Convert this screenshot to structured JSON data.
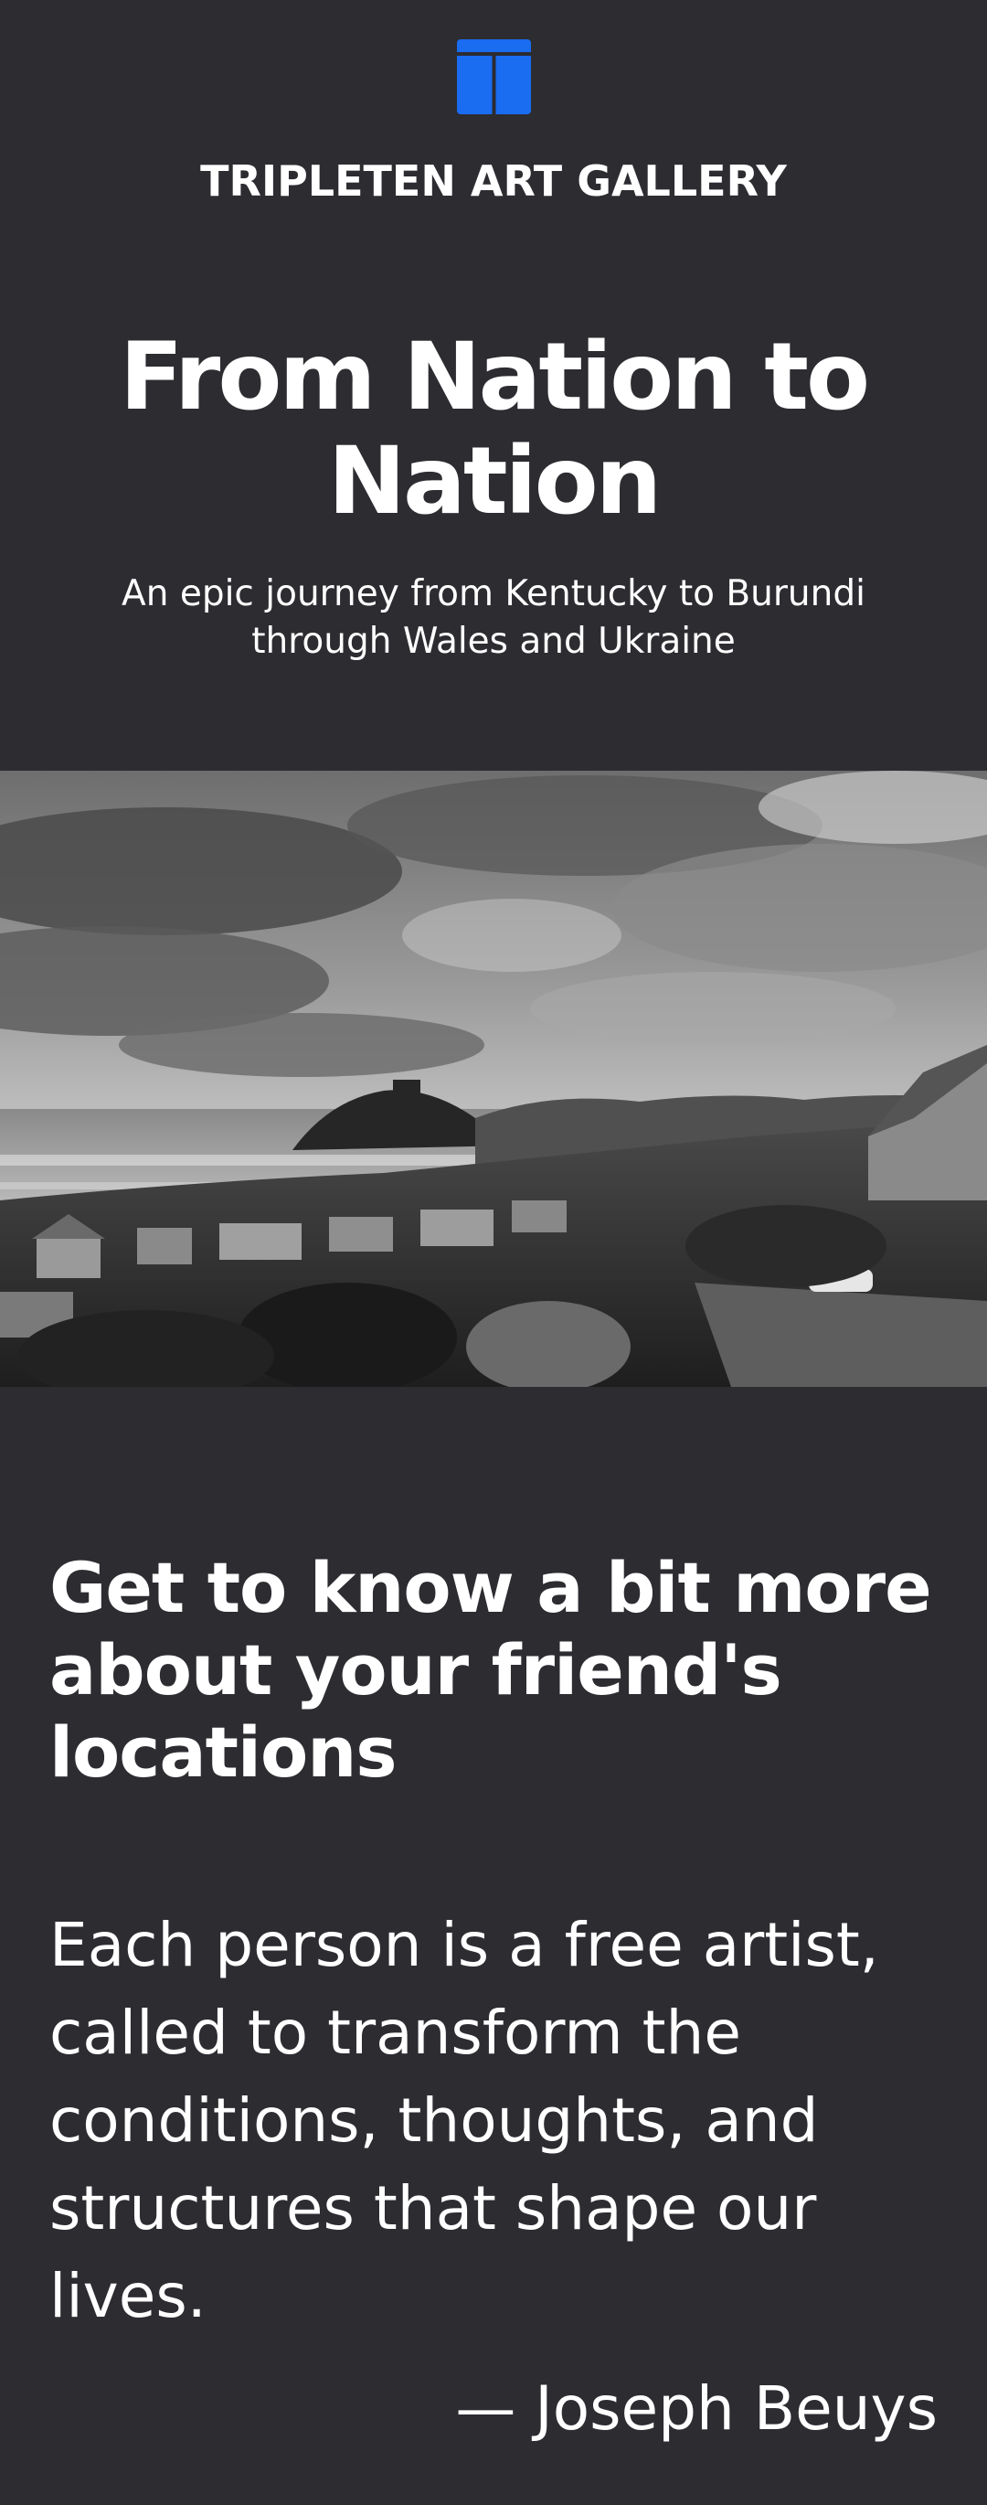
{
  "header": {
    "logo_icon": "gallery-logo-icon",
    "brand": "TRIPLETEN ART GALLERY",
    "accent_color": "#1a6cf0"
  },
  "hero": {
    "title": "From Nation to Nation",
    "subtitle": "An epic journey from Kentucky to Burundi through Wales and Ukraine",
    "image_description_icon": "coastal-town-photo"
  },
  "about": {
    "heading": "Get to know a bit more about your friend's locations",
    "quote": "Each person is a free artist, called to transform the conditions, thoughts, and structures that shape our lives.",
    "author": "— Joseph Beuys"
  }
}
